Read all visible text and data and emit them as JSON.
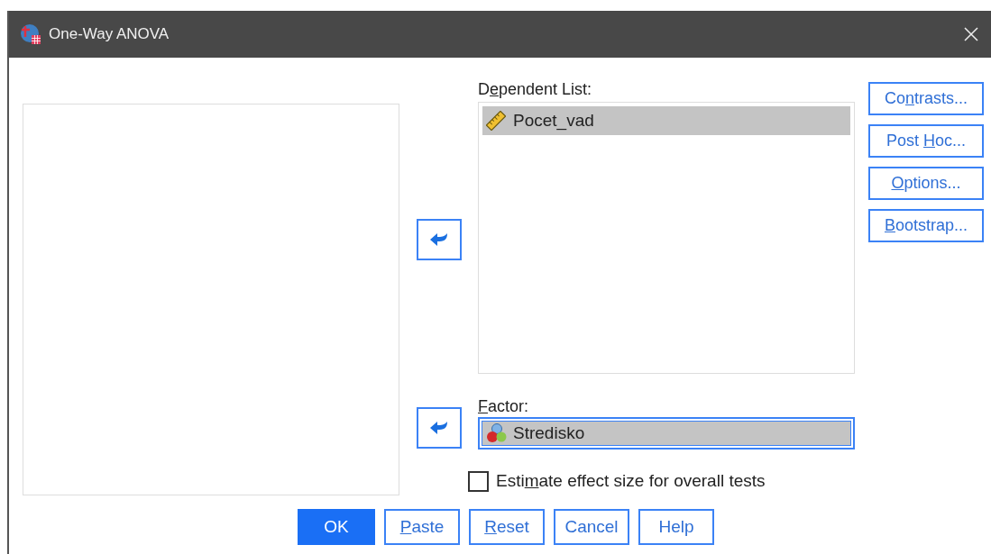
{
  "window": {
    "title": "One-Way ANOVA"
  },
  "dependent_list": {
    "label": {
      "pre": "D",
      "key": "e",
      "post": "pendent List:"
    },
    "items": [
      {
        "name": "Pocet_vad",
        "kind": "scale",
        "selected": true
      }
    ]
  },
  "factor": {
    "label": {
      "key": "F",
      "post": "actor:"
    },
    "value": "Stredisko",
    "kind": "nominal"
  },
  "side_buttons": [
    {
      "label": {
        "pre": "Co",
        "key": "n",
        "post": "trasts..."
      }
    },
    {
      "label": {
        "pre": "Post ",
        "key": "H",
        "post": "oc..."
      }
    },
    {
      "label": {
        "key": "O",
        "post": "ptions..."
      }
    },
    {
      "label": {
        "key": "B",
        "post": "ootstrap..."
      }
    }
  ],
  "effect_size": {
    "label": {
      "pre": "Esti",
      "key": "m",
      "post": "ate effect size for overall tests"
    },
    "checked": false
  },
  "buttons": [
    {
      "label": {
        "pre": "OK"
      },
      "default": true
    },
    {
      "label": {
        "key": "P",
        "post": "aste"
      },
      "default": false
    },
    {
      "label": {
        "key": "R",
        "post": "eset"
      },
      "default": false
    },
    {
      "label": {
        "pre": "Cancel"
      },
      "default": false
    },
    {
      "label": {
        "pre": "Help"
      },
      "default": false
    }
  ]
}
